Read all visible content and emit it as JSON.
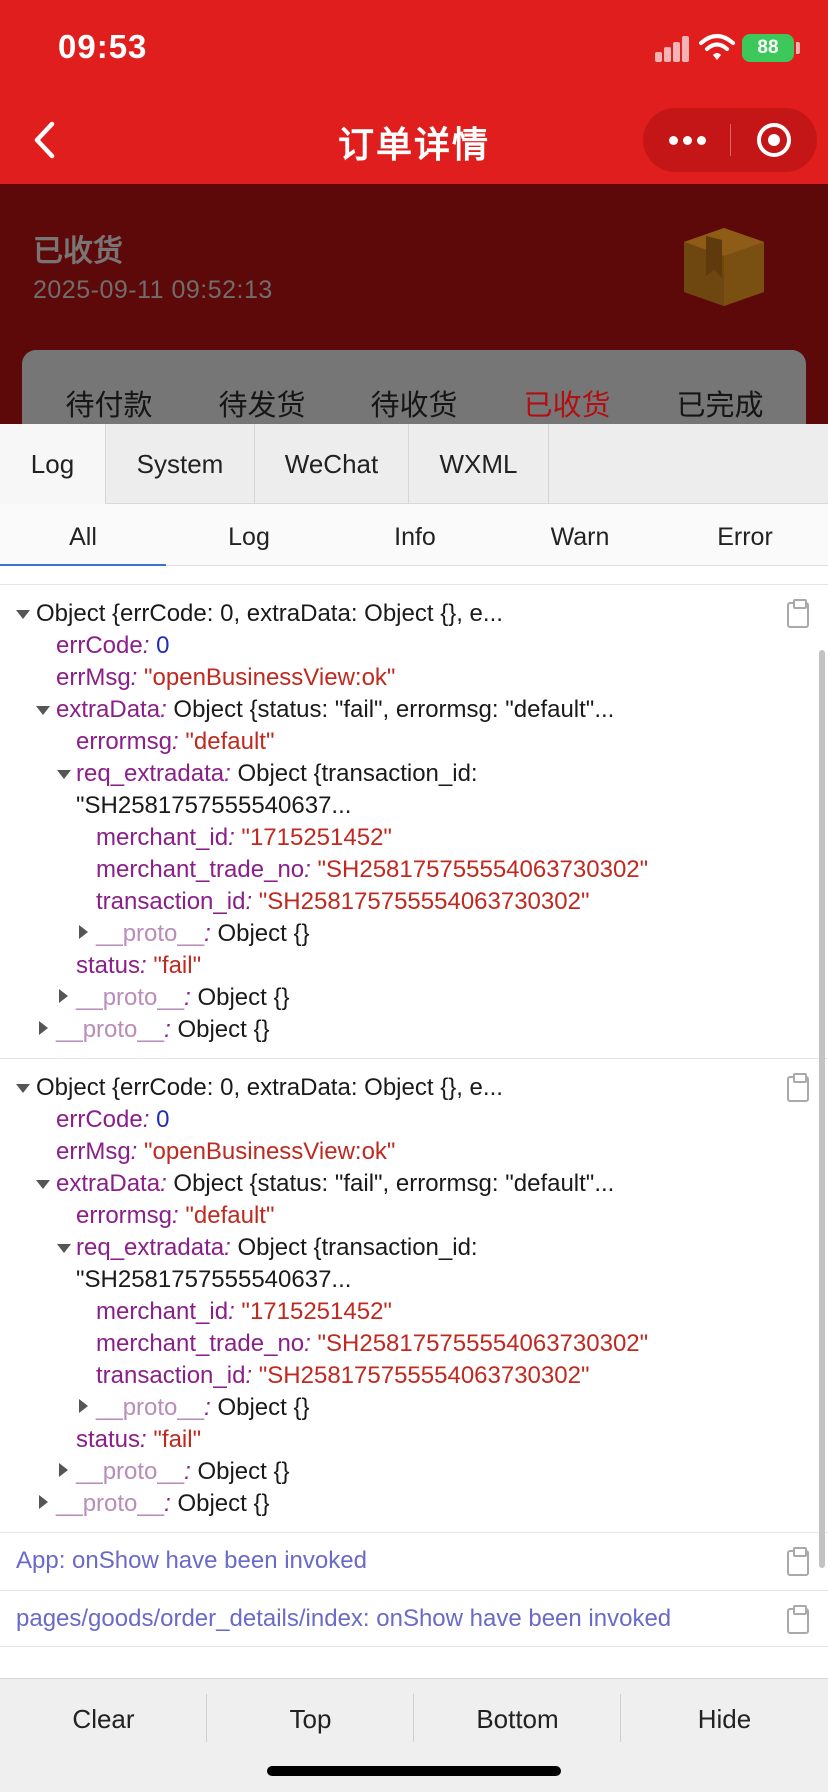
{
  "status_bar": {
    "time": "09:53",
    "battery": "88"
  },
  "nav": {
    "title": "订单详情",
    "back_icon": "chevron-left-icon",
    "more_icon": "more-dots-icon",
    "close_icon": "target-circle-icon"
  },
  "order": {
    "status": "已收货",
    "time": "2025-09-11 09:52:13",
    "icon": "package-box-icon",
    "steps": [
      "待付款",
      "待发货",
      "待收货",
      "已收货",
      "已完成"
    ],
    "active_step": 3
  },
  "console": {
    "tabs": [
      "Log",
      "System",
      "WeChat",
      "WXML"
    ],
    "subtabs": [
      "All",
      "Log",
      "Info",
      "Warn",
      "Error"
    ],
    "log_entries": [
      {
        "summary": "Object {errCode: 0, extraData: Object {}, e...",
        "errCode_key": "errCode",
        "errCode_val": "0",
        "errMsg_key": "errMsg",
        "errMsg_val": "\"openBusinessView:ok\"",
        "extraData_key": "extraData",
        "extraData_summary": "Object {status: \"fail\", errormsg: \"default\"...",
        "errormsg_key": "errormsg",
        "errormsg_val": "\"default\"",
        "req_key": "req_extradata",
        "req_summary": "Object {transaction_id:",
        "req_summary_cont": "\"SH2581757555540637...",
        "merchant_id_key": "merchant_id",
        "merchant_id_val": "\"1715251452\"",
        "trade_no_key": "merchant_trade_no",
        "trade_no_val": "\"SH258175755554063730302\"",
        "txn_key": "transaction_id",
        "txn_val": "\"SH258175755554063730302\"",
        "proto_key": "__proto__",
        "proto_val": "Object {}",
        "status_key": "status",
        "status_val": "\"fail\""
      },
      {
        "summary": "Object {errCode: 0, extraData: Object {}, e...",
        "errCode_key": "errCode",
        "errCode_val": "0",
        "errMsg_key": "errMsg",
        "errMsg_val": "\"openBusinessView:ok\"",
        "extraData_key": "extraData",
        "extraData_summary": "Object {status: \"fail\", errormsg: \"default\"...",
        "errormsg_key": "errormsg",
        "errormsg_val": "\"default\"",
        "req_key": "req_extradata",
        "req_summary": "Object {transaction_id:",
        "req_summary_cont": "\"SH2581757555540637...",
        "merchant_id_key": "merchant_id",
        "merchant_id_val": "\"1715251452\"",
        "trade_no_key": "merchant_trade_no",
        "trade_no_val": "\"SH258175755554063730302\"",
        "txn_key": "transaction_id",
        "txn_val": "\"SH258175755554063730302\"",
        "proto_key": "__proto__",
        "proto_val": "Object {}",
        "status_key": "status",
        "status_val": "\"fail\""
      }
    ],
    "info_lines": [
      "App: onShow have been invoked",
      "pages/goods/order_details/index: onShow have been invoked"
    ],
    "toolbar": [
      "Clear",
      "Top",
      "Bottom",
      "Hide"
    ]
  },
  "colors": {
    "nav_red": "#e01e1e",
    "header_dark": "#5e0909",
    "active_step": "#b30f12",
    "info_text": "#6a6ac8"
  }
}
